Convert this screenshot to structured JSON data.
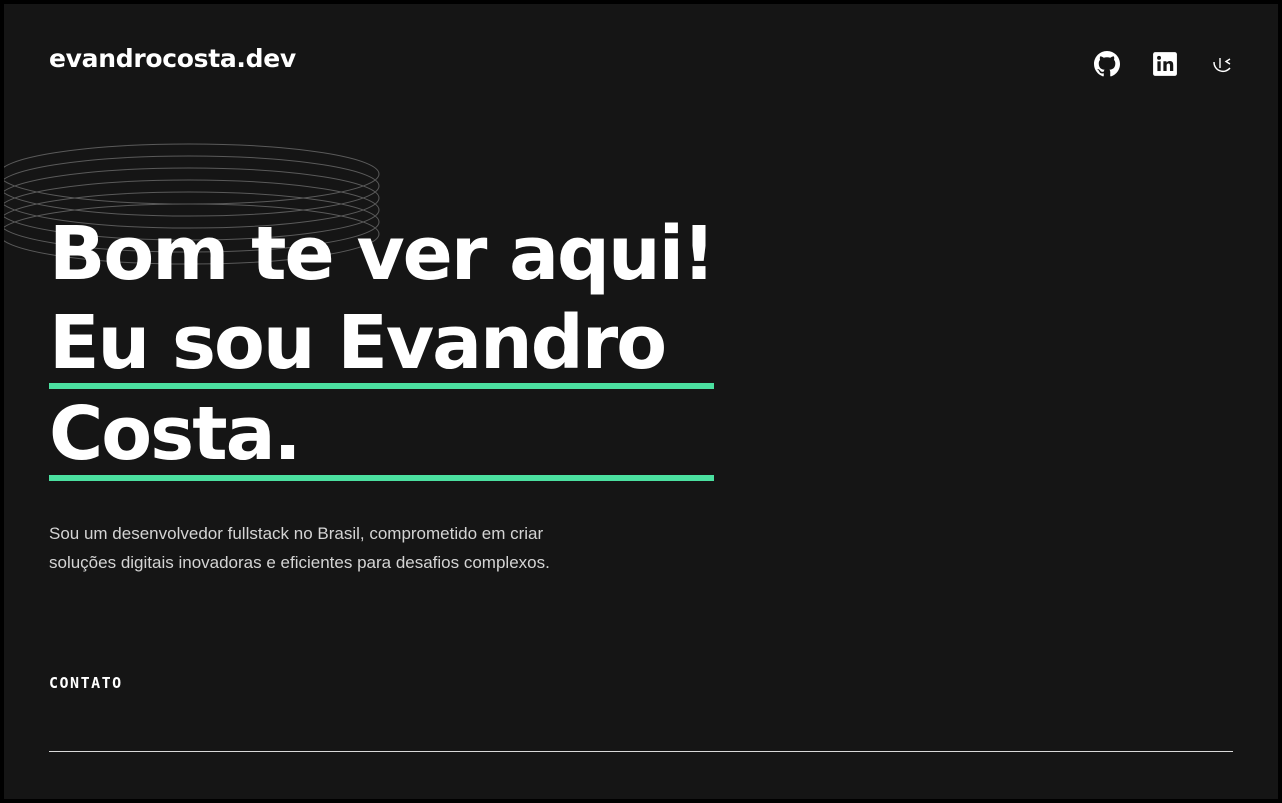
{
  "header": {
    "brand": "evandrocosta.dev",
    "social_icons": [
      "github-icon",
      "linkedin-icon",
      "orbit-logo-icon"
    ]
  },
  "hero": {
    "line1": "Bom te ver aqui!",
    "line2": "Eu sou Evandro",
    "line3": "Costa.",
    "intro": "Sou um desenvolvedor fullstack no Brasil, comprometido em criar soluções digitais inovadoras e eficientes para desafios complexos.",
    "contact_label": "CONTATO"
  },
  "colors": {
    "background": "#151515",
    "accent": "#4be0a0",
    "text": "#ffffff",
    "muted_text": "#d4d4d4"
  }
}
